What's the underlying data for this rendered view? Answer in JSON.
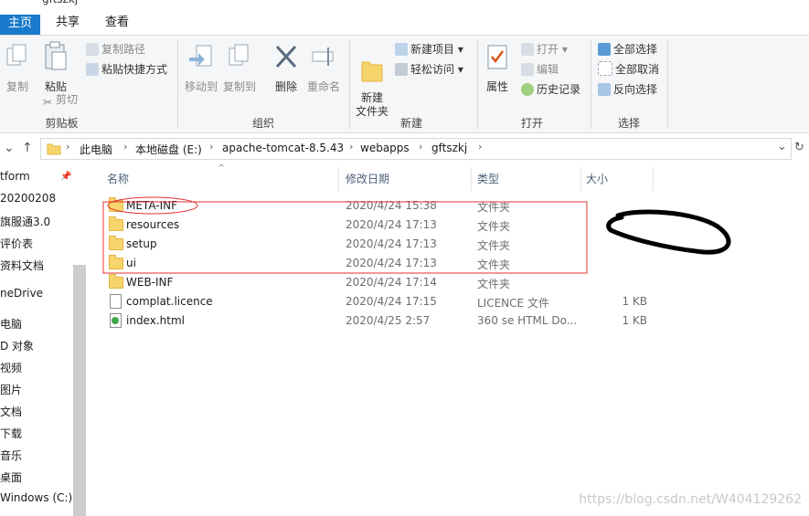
{
  "window": {
    "title": "gftszkj"
  },
  "tabs": [
    "主页",
    "共享",
    "查看"
  ],
  "ribbon": {
    "clipboard": {
      "copy": "复制",
      "paste": "粘贴",
      "copy_path": "复制路径",
      "paste_shortcut": "粘贴快捷方式",
      "cut": "剪切",
      "label": "剪贴板"
    },
    "organize": {
      "move_to": "移动到",
      "copy_to": "复制到",
      "delete": "删除",
      "rename": "重命名",
      "label": "组织"
    },
    "new": {
      "new_folder": "新建\n文件夹",
      "new_item": "新建项目",
      "easy_access": "轻松访问",
      "label": "新建"
    },
    "open": {
      "properties": "属性",
      "open": "打开",
      "edit": "编辑",
      "history": "历史记录",
      "label": "打开"
    },
    "select": {
      "select_all": "全部选择",
      "select_none": "全部取消",
      "invert": "反向选择",
      "label": "选择"
    }
  },
  "address": {
    "crumbs": [
      "此电脑",
      "本地磁盘 (E:)",
      "apache-tomcat-8.5.43",
      "webapps",
      "gftszkj"
    ]
  },
  "nav": [
    "tform",
    "20200208",
    "旗服通3.0",
    "评价表",
    "资料文档",
    "neDrive",
    "电脑",
    "D 对象",
    "视频",
    "图片",
    "文档",
    "下载",
    "音乐",
    "桌面",
    "Windows (C:)"
  ],
  "columns": {
    "name": "名称",
    "date": "修改日期",
    "type": "类型",
    "size": "大小"
  },
  "files": [
    {
      "name": "META-INF",
      "date": "2020/4/24 15:38",
      "type": "文件夹",
      "size": "",
      "icon": "folder-icon"
    },
    {
      "name": "resources",
      "date": "2020/4/24 17:13",
      "type": "文件夹",
      "size": "",
      "icon": "folder-icon"
    },
    {
      "name": "setup",
      "date": "2020/4/24 17:13",
      "type": "文件夹",
      "size": "",
      "icon": "folder-icon"
    },
    {
      "name": "ui",
      "date": "2020/4/24 17:13",
      "type": "文件夹",
      "size": "",
      "icon": "folder-icon"
    },
    {
      "name": "WEB-INF",
      "date": "2020/4/24 17:14",
      "type": "文件夹",
      "size": "",
      "icon": "folder-icon"
    },
    {
      "name": "complat.licence",
      "date": "2020/4/24 17:15",
      "type": "LICENCE 文件",
      "size": "1 KB",
      "icon": "file-icon"
    },
    {
      "name": "index.html",
      "date": "2020/4/25 2:57",
      "type": "360 se HTML Do...",
      "size": "1 KB",
      "icon": "html-icon"
    }
  ],
  "watermark": "https://blog.csdn.net/W404129262"
}
